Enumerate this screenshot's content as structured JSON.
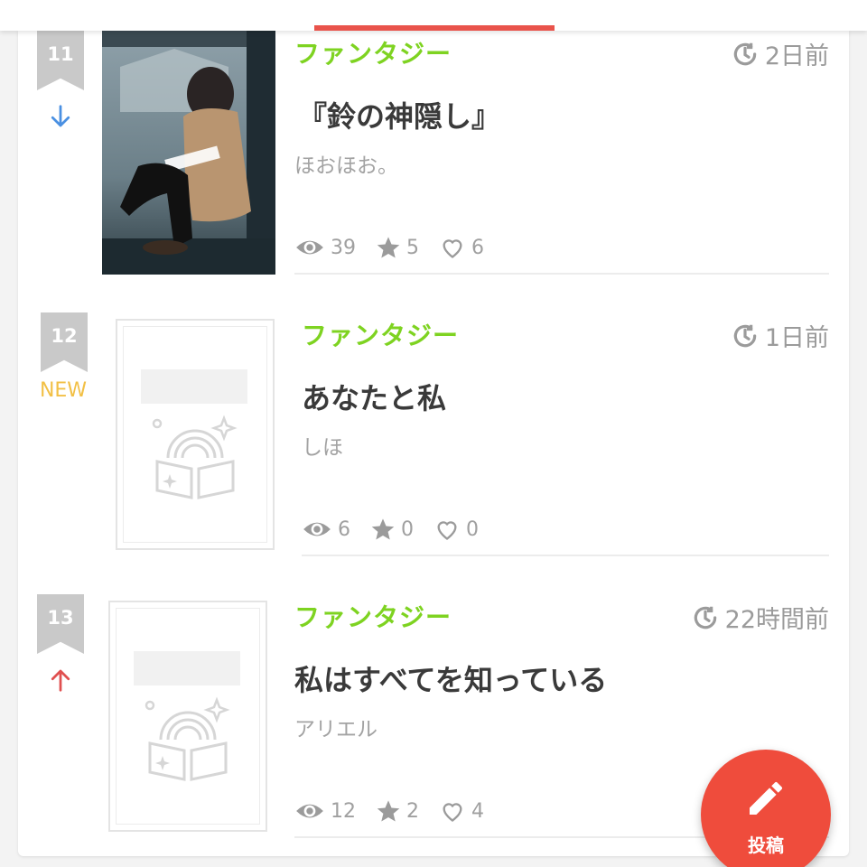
{
  "colors": {
    "accent": "#e9534b",
    "genre": "#7ed321",
    "rank_badge": "#c9c9c9",
    "trend_down": "#4a90e2",
    "trend_up": "#e05050",
    "trend_new": "#f2c046",
    "fab": "#ef4c3c"
  },
  "items": [
    {
      "rank": "11",
      "trend": "down",
      "trend_icon": "arrow-down-icon",
      "genre": "ファンタジー",
      "time": "2日前",
      "title": "『鈴の神隠し』",
      "author": "ほおほお。",
      "views": "39",
      "stars": "5",
      "likes": "6",
      "thumbnail": "photo-cover"
    },
    {
      "rank": "12",
      "trend": "new",
      "trend_label": "NEW",
      "genre": "ファンタジー",
      "time": "1日前",
      "title": "あなたと私",
      "author": "しほ",
      "views": "6",
      "stars": "0",
      "likes": "0",
      "thumbnail": "placeholder-book-cover"
    },
    {
      "rank": "13",
      "trend": "up",
      "trend_icon": "arrow-up-icon",
      "genre": "ファンタジー",
      "time": "22時間前",
      "title": "私はすべてを知っている",
      "author": "アリエル",
      "views": "12",
      "stars": "2",
      "likes": "4",
      "thumbnail": "placeholder-book-cover"
    }
  ],
  "fab": {
    "label": "投稿",
    "icon": "pencil-icon"
  }
}
